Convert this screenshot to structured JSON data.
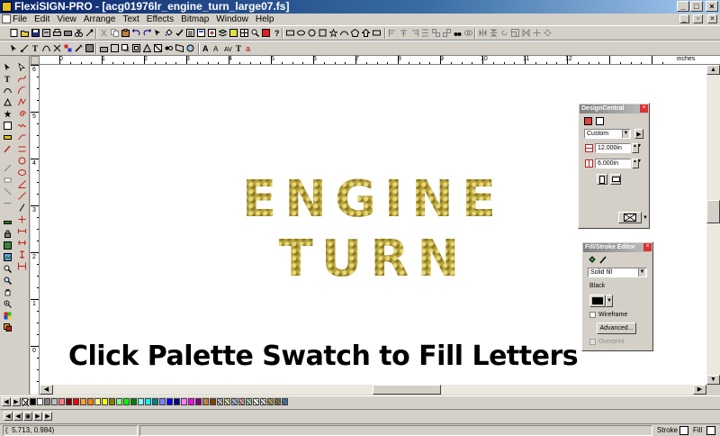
{
  "window": {
    "title": "FlexiSIGN-PRO - [acg01976lr_engine_turn_large07.fs]",
    "minimize": "_",
    "maximize": "□",
    "close": "×"
  },
  "menu": {
    "items": [
      "File",
      "Edit",
      "View",
      "Arrange",
      "Text",
      "Effects",
      "Bitmap",
      "Window",
      "Help"
    ]
  },
  "ruler": {
    "units": "inches",
    "h_numbers": [
      "0",
      "1",
      "2",
      "3",
      "4",
      "5",
      "6",
      "7",
      "8",
      "9",
      "10",
      "11",
      "12"
    ],
    "v_numbers": [
      "6",
      "5",
      "4",
      "3",
      "2",
      "1",
      "0"
    ]
  },
  "canvas": {
    "line1": "ENGINE",
    "line2": "TURN",
    "caption": "Click Palette Swatch to Fill Letters",
    "fill_color": "#b9a43a"
  },
  "design_central": {
    "title": "DesignCentral",
    "mode": "Custom",
    "width": "12.000in",
    "height": "6.000in"
  },
  "fill_stroke": {
    "title": "Fill/Stroke Editor",
    "fill_type": "Solid fill",
    "color_name": "Black",
    "wireframe_label": "Wireframe",
    "advanced_label": "Advanced...",
    "overprint_label": "Overprint"
  },
  "palette": {
    "colors": [
      "#000000",
      "#ffffff",
      "#808080",
      "#c0c0c0",
      "#ff8080",
      "#800000",
      "#ff0000",
      "#ffa040",
      "#ff8000",
      "#ffff80",
      "#ffff00",
      "#808000",
      "#80ff80",
      "#00ff00",
      "#008000",
      "#80ffff",
      "#00ffff",
      "#008080",
      "#8080ff",
      "#0000ff",
      "#000080",
      "#ff80ff",
      "#ff00ff",
      "#800080",
      "#c08040",
      "#804000"
    ]
  },
  "status": {
    "coords": "5.713,     0.984)",
    "stroke_label": "Stroke",
    "fill_label": "Fill"
  }
}
